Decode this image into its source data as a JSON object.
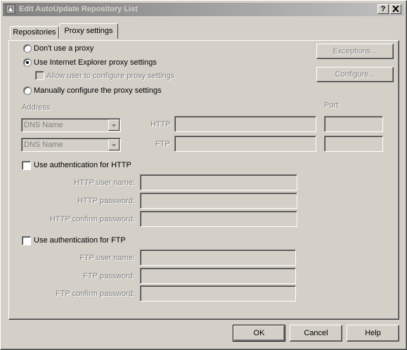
{
  "window": {
    "title": "Edit AutoUpdate Repository List",
    "help_btn": "?",
    "close_btn": "X"
  },
  "tabs": [
    "Repositories",
    "Proxy settings"
  ],
  "options": {
    "no_proxy": "Don't use a proxy",
    "ie_proxy": "Use Internet Explorer proxy settings",
    "allow_user": "Allow user to configure proxy settings",
    "manual": "Manually configure the proxy settings"
  },
  "buttons_side": {
    "exceptions": "Exceptions...",
    "configure": "Configure..."
  },
  "address": {
    "label": "Address",
    "port_label": "Port",
    "http_select": "DNS Name",
    "ftp_select": "DNS Name",
    "http_label": "HTTP",
    "ftp_label": "FTP"
  },
  "http_auth": {
    "checkbox": "Use authentication for HTTP",
    "user": "HTTP user name:",
    "password": "HTTP password:",
    "confirm": "HTTP confirm password:"
  },
  "ftp_auth": {
    "checkbox": "Use authentication for FTP",
    "user": "FTP user name:",
    "password": "FTP password:",
    "confirm": "FTP confirm password:"
  },
  "footer": {
    "ok": "OK",
    "cancel": "Cancel",
    "help": "Help"
  }
}
